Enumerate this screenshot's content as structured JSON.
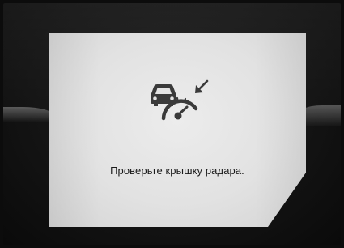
{
  "warning": {
    "message": "Проверьте крышку радара.",
    "icon": "radar-cover-warning-icon"
  },
  "colors": {
    "panel": "#e6e6e6",
    "icon": "#3a3a3a",
    "text": "#1a1a1a",
    "background": "#0c0c0c"
  }
}
